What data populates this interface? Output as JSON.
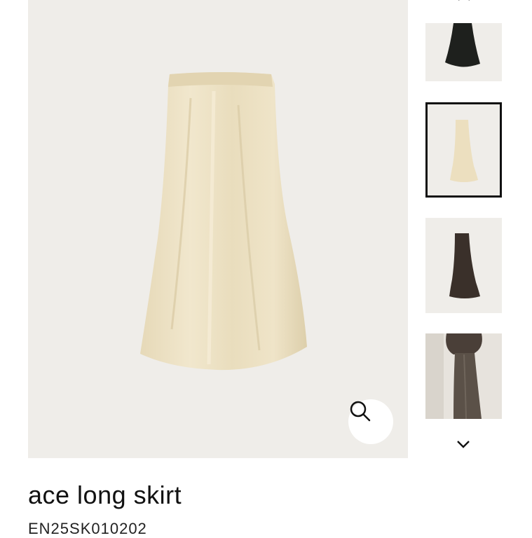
{
  "product": {
    "title": "ace long skirt",
    "code": "EN25SK010202"
  },
  "gallery": {
    "main_image": "cream-satin-maxi-skirt",
    "zoom_icon": "magnifier-icon",
    "thumbnails": [
      {
        "name": "black-skirt-thumbnail",
        "selected": false
      },
      {
        "name": "cream-skirt-thumbnail",
        "selected": true
      },
      {
        "name": "brown-skirt-thumbnail",
        "selected": false
      },
      {
        "name": "model-wearing-skirt-thumbnail",
        "selected": false
      }
    ],
    "nav_up_icon": "chevron-up-icon",
    "nav_down_icon": "chevron-down-icon"
  },
  "colors": {
    "image_bg": "#efede9",
    "cream_fabric": "#ede2c4",
    "black_fabric": "#1e201d",
    "brown_fabric": "#3a302a",
    "selected_border": "#111111"
  }
}
